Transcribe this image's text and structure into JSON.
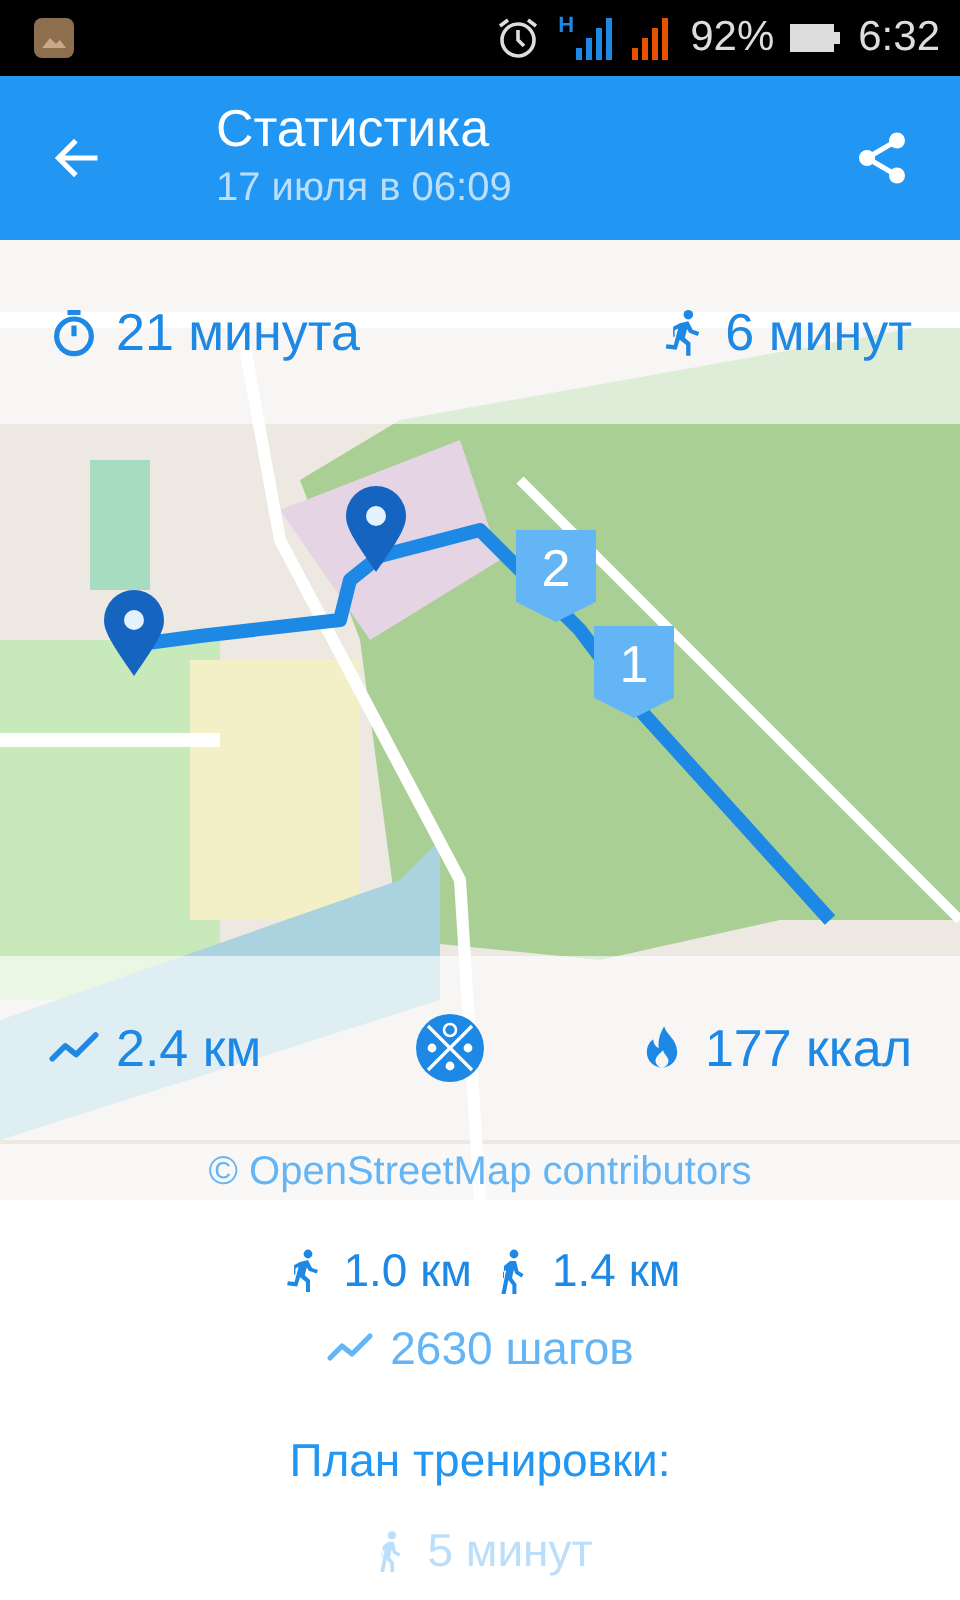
{
  "status_bar": {
    "network": "H",
    "battery": "92%",
    "time": "6:32"
  },
  "app_bar": {
    "title": "Статистика",
    "subtitle": "17 июля в 06:09"
  },
  "map": {
    "markers": [
      "2",
      "1"
    ],
    "attribution": "© OpenStreetMap contributors"
  },
  "stats_top": [
    {
      "kind": "duration",
      "text": "21 минута"
    },
    {
      "kind": "run",
      "text": "6 минут"
    }
  ],
  "stats_bottom": [
    {
      "kind": "distance",
      "text": "2.4 км"
    },
    {
      "kind": "calories",
      "text": "177 ккал"
    }
  ],
  "breakdown": [
    {
      "kind": "run",
      "text": "1.0 км"
    },
    {
      "kind": "walk",
      "text": "1.4 км"
    }
  ],
  "steps": {
    "kind": "distance",
    "text": "2630 шагов"
  },
  "plan": {
    "title": "План тренировки:",
    "items": [
      {
        "kind": "walk",
        "text": "5 минут"
      }
    ]
  }
}
